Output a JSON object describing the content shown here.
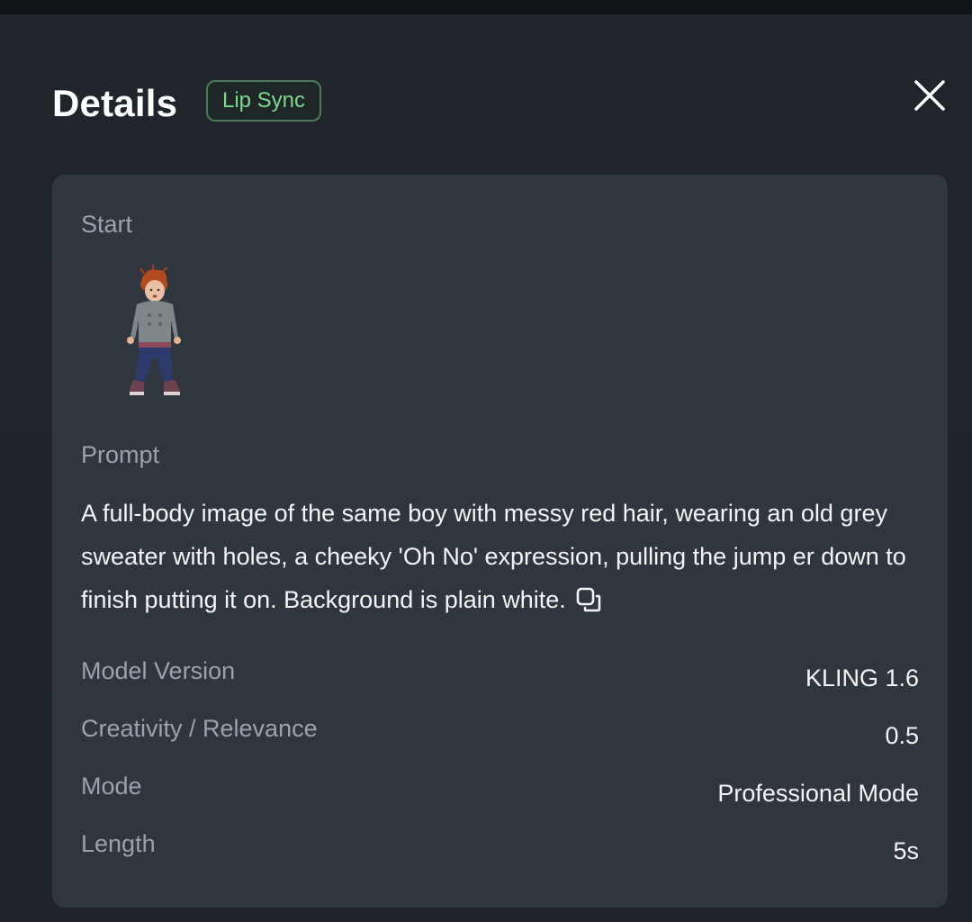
{
  "header": {
    "title": "Details",
    "badge": "Lip Sync"
  },
  "start": {
    "label": "Start",
    "thumbnail": "boy-figure-thumbnail"
  },
  "prompt": {
    "label": "Prompt",
    "text": "A full-body image of the same boy with messy red hair, wearing an old grey sweater with holes, a cheeky 'Oh No' expression, pulling the jump er down to finish putting it on. Background is plain white."
  },
  "details": [
    {
      "label": "Model Version",
      "value": "KLING 1.6"
    },
    {
      "label": "Creativity / Relevance",
      "value": "0.5"
    },
    {
      "label": "Mode",
      "value": "Professional Mode"
    },
    {
      "label": "Length",
      "value": "5s"
    }
  ],
  "icons": {
    "close": "close-icon",
    "copy": "copy-icon"
  },
  "colors": {
    "background": "#1f242a",
    "card": "#30363d",
    "badge_text": "#7bd88f",
    "badge_border": "#4a7a56",
    "label": "#9aa3ad",
    "value": "#f2f4f6"
  }
}
